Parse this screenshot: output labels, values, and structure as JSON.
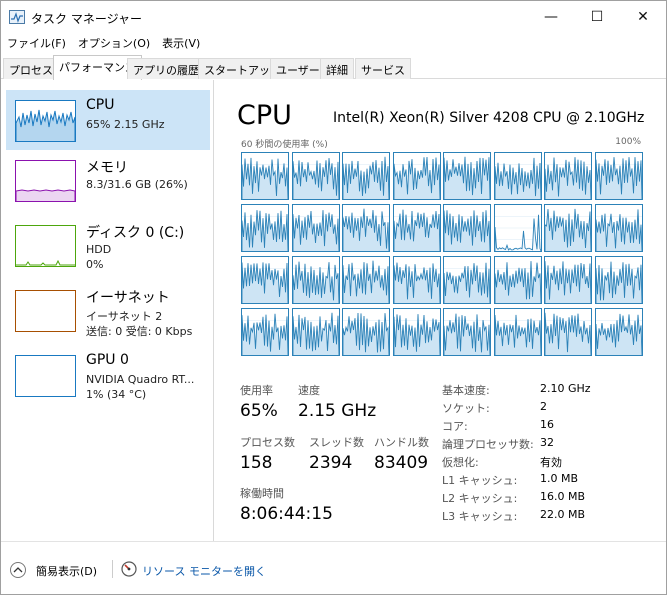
{
  "window": {
    "title": "タスク マネージャー"
  },
  "title_controls": {
    "minimize": "—",
    "maximize": "☐",
    "close": "✕"
  },
  "menu": [
    "ファイル(F)",
    "オプション(O)",
    "表示(V)"
  ],
  "tabs": [
    "プロセス",
    "パフォーマンス",
    "アプリの履歴",
    "スタートアップ",
    "ユーザー",
    "詳細",
    "サービス"
  ],
  "active_tab": "パフォーマンス",
  "sidebar": [
    {
      "name": "CPU",
      "line1": "65%  2.15 GHz",
      "line2": "",
      "line3": "",
      "color": "#1979c1",
      "selected": true
    },
    {
      "name": "メモリ",
      "line1": "8.3/31.6 GB (26%)",
      "line2": "",
      "line3": "",
      "color": "#8b12ae",
      "selected": false
    },
    {
      "name": "ディスク 0 (C:)",
      "line1": "HDD",
      "line2": "0%",
      "line3": "",
      "color": "#4da60c",
      "selected": false
    },
    {
      "name": "イーサネット",
      "line1": "イーサネット 2",
      "line2": "送信: 0  受信: 0 Kbps",
      "line3": "",
      "color": "#a74f01",
      "selected": false
    },
    {
      "name": "GPU 0",
      "line1": "NVIDIA Quadro RT...",
      "line2": "1%  (34 °C)",
      "line3": "",
      "color": "#1979c1",
      "selected": false
    }
  ],
  "main": {
    "title": "CPU",
    "model": "Intel(R) Xeon(R) Silver 4208 CPU @ 2.10GHz",
    "graph_label": "60 秒間の使用率 (%)",
    "graph_max": "100%",
    "logical_processor_graphs": 32,
    "accent_color": "#2c82b8",
    "utilization": {
      "label": "使用率",
      "value": "65%"
    },
    "speed": {
      "label": "速度",
      "value": "2.15 GHz"
    },
    "processes": {
      "label": "プロセス数",
      "value": "158"
    },
    "threads": {
      "label": "スレッド数",
      "value": "2394"
    },
    "handles": {
      "label": "ハンドル数",
      "value": "83409"
    },
    "uptime": {
      "label": "稼働時間",
      "value": "8:06:44:15"
    },
    "specs": [
      {
        "key": "基本速度:",
        "value": "2.10 GHz"
      },
      {
        "key": "ソケット:",
        "value": "2"
      },
      {
        "key": "コア:",
        "value": "16"
      },
      {
        "key": "論理プロセッサ数:",
        "value": "32"
      },
      {
        "key": "仮想化:",
        "value": "有効"
      },
      {
        "key": "L1 キャッシュ:",
        "value": "1.0 MB"
      },
      {
        "key": "L2 キャッシュ:",
        "value": "16.0 MB"
      },
      {
        "key": "L3 キャッシュ:",
        "value": "22.0 MB"
      }
    ]
  },
  "bottom": {
    "collapse_label": "簡易表示(D)",
    "resmon_label": "リソース モニターを開く"
  }
}
